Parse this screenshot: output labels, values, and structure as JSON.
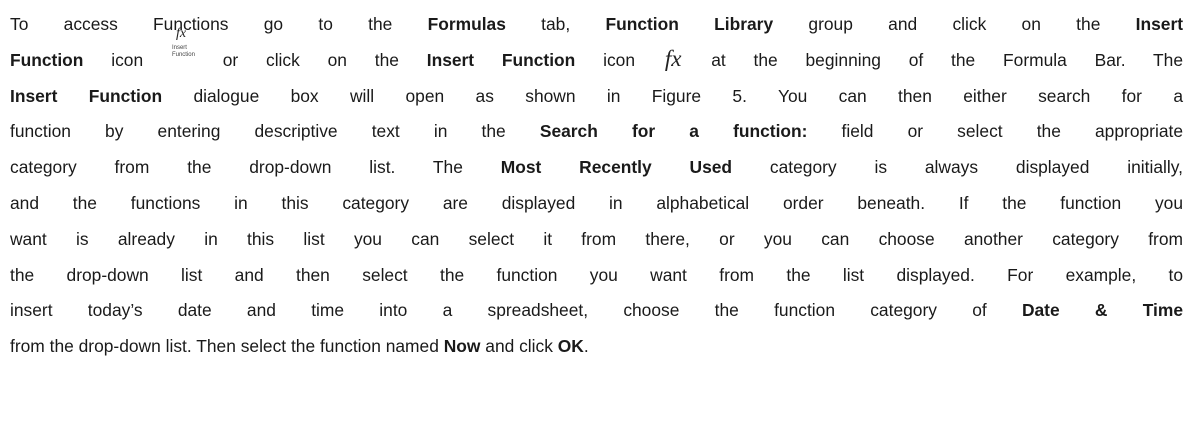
{
  "paragraph": {
    "l1_a": "To access Functions go to the ",
    "l1_b": "Formulas",
    "l1_c": " tab, ",
    "l1_d": "Function Library",
    "l1_e": " group and click on the ",
    "l1_f": "Insert",
    "l2_a": "Function",
    "l2_b": " icon ",
    "l2_c": " or click on the ",
    "l2_d": "Insert Function",
    "l2_e": " icon ",
    "l2_f": " at the beginning of the Formula Bar. The",
    "l3_a": "Insert Function",
    "l3_b": " dialogue box will open as shown in Figure 5. You can then either search for a",
    "l4_a": "function by entering descriptive text in the ",
    "l4_b": "Search for a function:",
    "l4_c": " field or select the appropriate",
    "l5_a": "category from the drop-down list. The ",
    "l5_b": "Most Recently Used",
    "l5_c": " category is always displayed initially,",
    "l6": "and the functions in this category are displayed in alphabetical order beneath. If the function you",
    "l7": "want is already in this list you can select it from there, or you can choose another category from",
    "l8": "the drop-down list and then select the function you want from the list displayed. For example, to",
    "l9_a": "insert today’s date and time into a spreadsheet, choose the function category of ",
    "l9_b": "Date & Time",
    "l10_a": "from the drop-down list. Then select the function named ",
    "l10_b": "Now",
    "l10_c": " and click ",
    "l10_d": "OK",
    "l10_e": "."
  },
  "ribbon_icon": {
    "glyph": "fx",
    "caption_line1": "Insert",
    "caption_line2": "Function"
  },
  "formula_bar_icon": {
    "glyph": "fx"
  }
}
